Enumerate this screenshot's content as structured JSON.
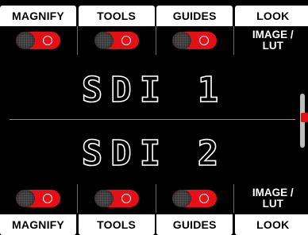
{
  "top_tabs": [
    {
      "label": "MAGNIFY"
    },
    {
      "label": "TOOLS"
    },
    {
      "label": "GUIDES"
    },
    {
      "label": "LOOK"
    }
  ],
  "top_look_value_line1": "IMAGE /",
  "top_look_value_line2": "LUT",
  "monitors": {
    "sdi1": "SDI 1",
    "sdi2": "SDI 2"
  },
  "bottom_look_value_line1": "IMAGE /",
  "bottom_look_value_line2": "LUT",
  "bottom_tabs": [
    {
      "label": "MAGNIFY"
    },
    {
      "label": "TOOLS"
    },
    {
      "label": "GUIDES"
    },
    {
      "label": "LOOK"
    }
  ],
  "toggles": {
    "top_magnify_on": true,
    "top_tools_on": true,
    "top_guides_on": true,
    "bottom_magnify_on": true,
    "bottom_tools_on": true,
    "bottom_guides_on": true
  },
  "colors": {
    "accent": "#e60f16",
    "background": "#000000",
    "tab_bg": "#ffffff"
  },
  "icons": {
    "toggle": "toggle-switch-icon",
    "scroll": "scroll-indicator-icon"
  }
}
